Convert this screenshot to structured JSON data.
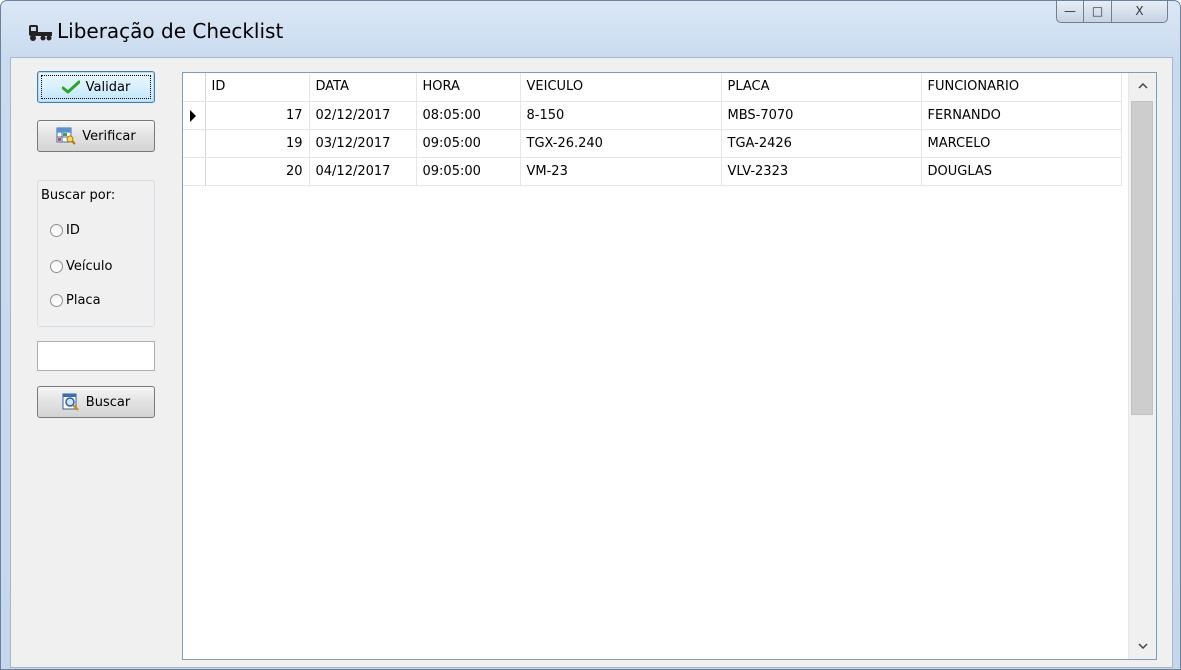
{
  "window": {
    "title": "Liberação de Checklist",
    "caption_buttons": {
      "minimize": "—",
      "maximize": "□",
      "close": "X"
    }
  },
  "sidebar": {
    "validar_label": "Validar",
    "verificar_label": "Verificar",
    "search_group_label": "Buscar por:",
    "radio_options": [
      {
        "label": "ID",
        "selected": false
      },
      {
        "label": "Veículo",
        "selected": false
      },
      {
        "label": "Placa",
        "selected": false
      }
    ],
    "search_value": "",
    "buscar_label": "Buscar"
  },
  "grid": {
    "columns": [
      "ID",
      "DATA",
      "HORA",
      "VEICULO",
      "PLACA",
      "FUNCIONARIO"
    ],
    "rows": [
      {
        "current": true,
        "cells": [
          "17",
          "02/12/2017",
          "08:05:00",
          "8-150",
          "MBS-7070",
          "FERNANDO"
        ]
      },
      {
        "current": false,
        "cells": [
          "19",
          "03/12/2017",
          "09:05:00",
          "TGX-26.240",
          "TGA-2426",
          "MARCELO"
        ]
      },
      {
        "current": false,
        "cells": [
          "20",
          "04/12/2017",
          "09:05:00",
          "VM-23",
          "VLV-2323",
          "DOUGLAS"
        ]
      }
    ],
    "scroll_up_icon": "chevron-up-icon",
    "scroll_down_icon": "chevron-down-icon"
  },
  "colors": {
    "validar_check": "#2aa52a",
    "window_frame": "#c4d7ed",
    "grid_border": "#7f9db9"
  }
}
